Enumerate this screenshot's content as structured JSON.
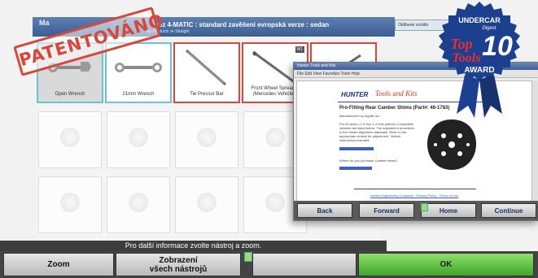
{
  "window": {
    "app_title": "Ma",
    "app_menu": "Nástroje & sady",
    "header_title": "bez 4-MATIC : standard zavěšení evropská verze : sedan",
    "header_sub": "lity Products  ≫  Straight",
    "search_text": "Oblíbené vozidlo"
  },
  "stamp": {
    "text": "PATENTOVÁNO",
    "color": "#d7473c"
  },
  "tools": [
    {
      "label": "Open Wrench",
      "icon": "open-wrench-icon",
      "border": "blue",
      "selected": true
    },
    {
      "label": "21mm Wrench",
      "icon": "wrench-icon",
      "border": "blue",
      "selected": false
    },
    {
      "label": "Tie Pressor Bar",
      "icon": "bar-icon",
      "border": "red",
      "selected": false
    },
    {
      "label": "Front Wheel Spreader (Mercedes Vehicles)",
      "icon": "spreader-icon",
      "border": "red",
      "selected": false,
      "badge": "W1"
    },
    {
      "label": "",
      "icon": "bar-icon",
      "border": "red",
      "selected": false
    }
  ],
  "status_text": "Pro další informace zvolte nástroj a zoom.",
  "buttons": {
    "zoom": "Zoom",
    "show_all_line1": "Zobrazení",
    "show_all_line2": "všech nástrojů",
    "ok": "OK"
  },
  "popup": {
    "title_bar": "Hunter Tools and Kits",
    "menu": "File  Edit  View  Favorites  Tools  Help",
    "brand_hunter": "HUNTER",
    "brand_tools": "Tools and Kits",
    "doc_title": "Pro-Fitting Rear Camber Shims (Part#: 46-1783)",
    "doc_intro": "Manufactured by Ingalls Inc.",
    "doc_text": "Pro-fit shims (.1.6 thru 1.4 hole pattern) Compatible vehicles are listed below. The adjustment procedure in the Hunter Alignment database. Refer to the appropriate vehicle for adjustment. Vehicle instructions included.",
    "doc_question": "Where do you purchase Camber shims?",
    "doc_footer": "Hunter Engineering Company  ·  Privacy Policy  ·  Terms of Use",
    "buttons": [
      "Back",
      "Forward",
      "Home",
      "Continue"
    ]
  },
  "award": {
    "line1": "UNDERCAR",
    "line2": "Digest",
    "line3": "Top",
    "line4": "10",
    "line5": "Tools",
    "line6": "AWARD",
    "color_blue": "#1d3f8f",
    "color_red": "#e3312d"
  },
  "colors": {
    "accent_green": "#48b02b",
    "selected_blue": "#69c4d8",
    "selected_red": "#d9473b"
  }
}
